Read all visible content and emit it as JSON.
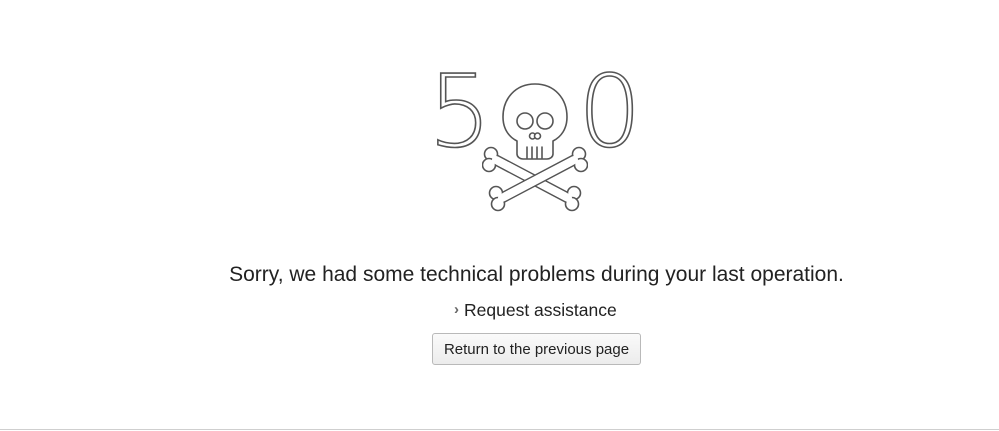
{
  "error": {
    "digit_left": "5",
    "digit_right": "0",
    "middle_icon": "skull-and-crossbones-icon",
    "message": "Sorry, we had some technical problems during your last operation."
  },
  "actions": {
    "assist_label": "Request assistance",
    "assist_icon": "chevron-right-icon",
    "return_label": "Return to the previous page"
  },
  "colors": {
    "background": "#ffffff",
    "graphic_stroke": "#555555",
    "text": "#222222"
  }
}
